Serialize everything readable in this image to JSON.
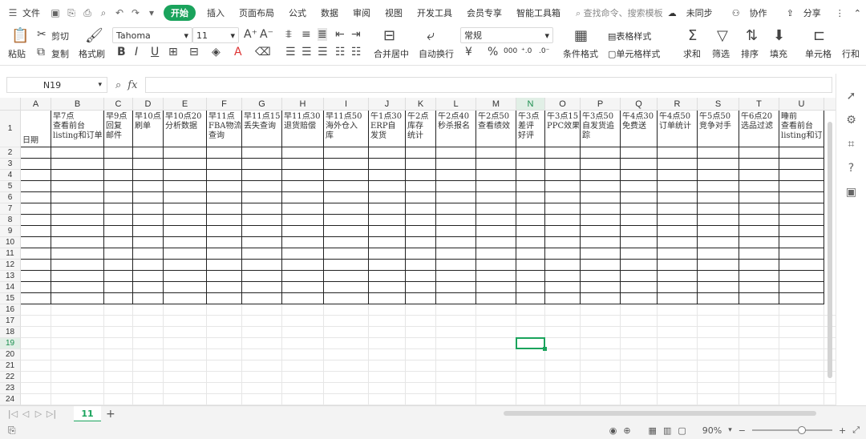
{
  "menubar": {
    "file": "文件",
    "tabs": [
      "开始",
      "插入",
      "页面布局",
      "公式",
      "数据",
      "审阅",
      "视图",
      "开发工具",
      "会员专享",
      "智能工具箱"
    ],
    "active_tab": "开始",
    "search_placeholder": "查找命令、搜索模板",
    "sync": "未同步",
    "collab": "协作",
    "share": "分享"
  },
  "ribbon": {
    "paste": "粘贴",
    "cut": "剪切",
    "copy": "复制",
    "format_painter": "格式刷",
    "font_name": "Tahoma",
    "font_size": "11",
    "merge_center": "合并居中",
    "wrap_text": "自动换行",
    "number_format": "常规",
    "conditional_format": "条件格式",
    "table_style": "表格样式",
    "cell_style": "单元格样式",
    "sum": "求和",
    "filter": "筛选",
    "sort": "排序",
    "fill": "填充",
    "cell": "单元格",
    "row_col": "行和"
  },
  "formula_bar": {
    "name_box": "N19",
    "fx": "fx"
  },
  "grid": {
    "columns": [
      "A",
      "B",
      "C",
      "D",
      "E",
      "F",
      "G",
      "H",
      "I",
      "J",
      "K",
      "L",
      "M",
      "N",
      "O",
      "P",
      "Q",
      "R",
      "S",
      "T",
      "U"
    ],
    "rows": [
      "1",
      "2",
      "3",
      "4",
      "5",
      "6",
      "7",
      "8",
      "9",
      "10",
      "11",
      "12",
      "13",
      "14",
      "15",
      "16",
      "17",
      "18",
      "19",
      "20",
      "21",
      "22",
      "23",
      "24"
    ],
    "active_column": "N",
    "active_row": "19",
    "header_cells": [
      "日期",
      "早7点\n查看前台\nlisting和订单",
      "早9点\n回复\n邮件",
      "早10点\n刷单",
      "早10点20\n分析数据",
      "早11点\nFBA物流\n查询",
      "早11点15\n丢失查询",
      "早11点30\n退货赔偿",
      "早11点50\n海外仓入\n库",
      "午1点30\nERP自\n发货",
      "午2点\n库存\n统计",
      "午2点40\n秒杀报名",
      "午2点50\n查看绩效",
      "午3点\n差评\n好评",
      "午3点15\nPPC效果",
      "午3点50\n自发货追\n踪",
      "午4点30\n免费送",
      "午4点50\n订单统计",
      "午5点50\n竞争对手",
      "午6点20\n选品过滤",
      "睡前\n查看前台\nlisting和订"
    ]
  },
  "sheet_tabs": {
    "active": "11",
    "add": "+"
  },
  "status": {
    "zoom": "90%",
    "zoom_fraction": 0.62
  }
}
